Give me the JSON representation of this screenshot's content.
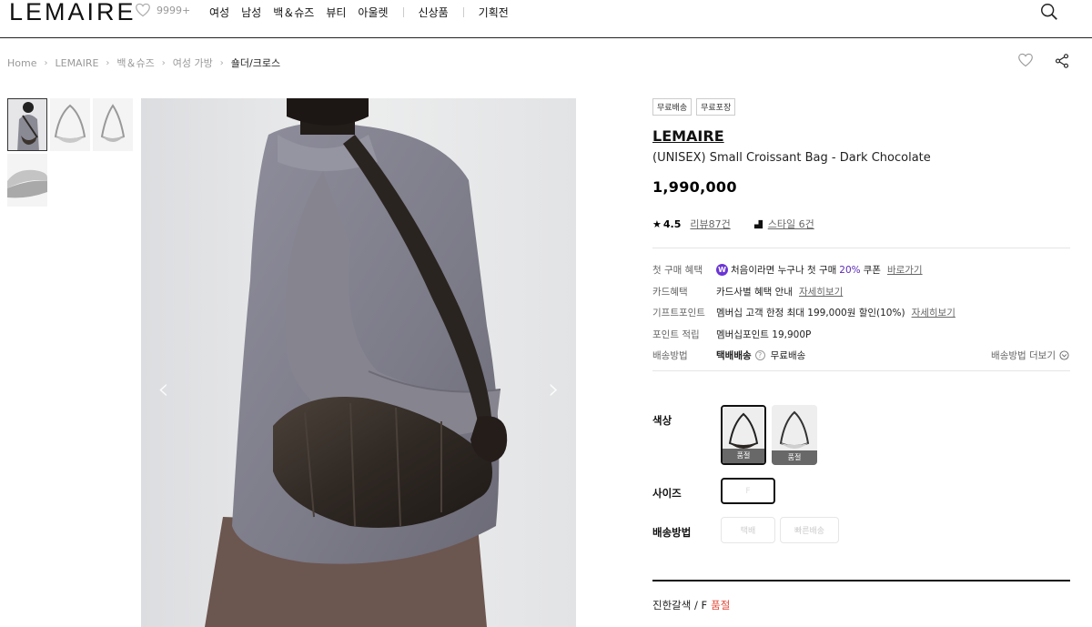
{
  "header": {
    "logo": "LEMAIRE",
    "like_count": "9999+",
    "nav": [
      "여성",
      "남성",
      "백＆슈즈",
      "뷰티",
      "아울렛"
    ],
    "nav_extra": [
      "신상품",
      "기획전"
    ]
  },
  "breadcrumb": [
    "Home",
    "LEMAIRE",
    "백＆슈즈",
    "여성 가방",
    "숄더/크로스"
  ],
  "tags": [
    "무료배송",
    "무료포장"
  ],
  "product": {
    "brand": "LEMAIRE",
    "name": "(UNISEX) Small Croissant Bag - Dark Chocolate",
    "price": "1,990,000",
    "rating": "4.5",
    "reviews": "리뷰87건",
    "styles": "스타일 6건"
  },
  "benefits": {
    "first_label": "첫 구매 혜택",
    "first_text": "처음이라면 누구나 첫 구매",
    "first_pct": "20%",
    "first_suffix": "쿠폰",
    "first_link": "바로가기",
    "card_label": "카드혜택",
    "card_text": "카드사별 혜택 안내",
    "card_link": "자세히보기",
    "gift_label": "기프트포인트",
    "gift_text": "멤버십 고객 한정 최대 199,000원 할인(10%)",
    "gift_link": "자세히보기",
    "point_label": "포인트 적립",
    "point_text": "멤버십포인트 19,900P",
    "ship_label": "배송방법",
    "ship_method": "택배배송",
    "ship_free": "무료배송",
    "ship_more": "배송방법 더보기"
  },
  "options": {
    "color_label": "색상",
    "colors": [
      "품절",
      "품절"
    ],
    "size_label": "사이즈",
    "size": "F",
    "delivery_label": "배송방법",
    "delivery": [
      "택배",
      "빠른배송"
    ]
  },
  "selected": {
    "text": "진한갈색 / F",
    "status": "품절"
  }
}
